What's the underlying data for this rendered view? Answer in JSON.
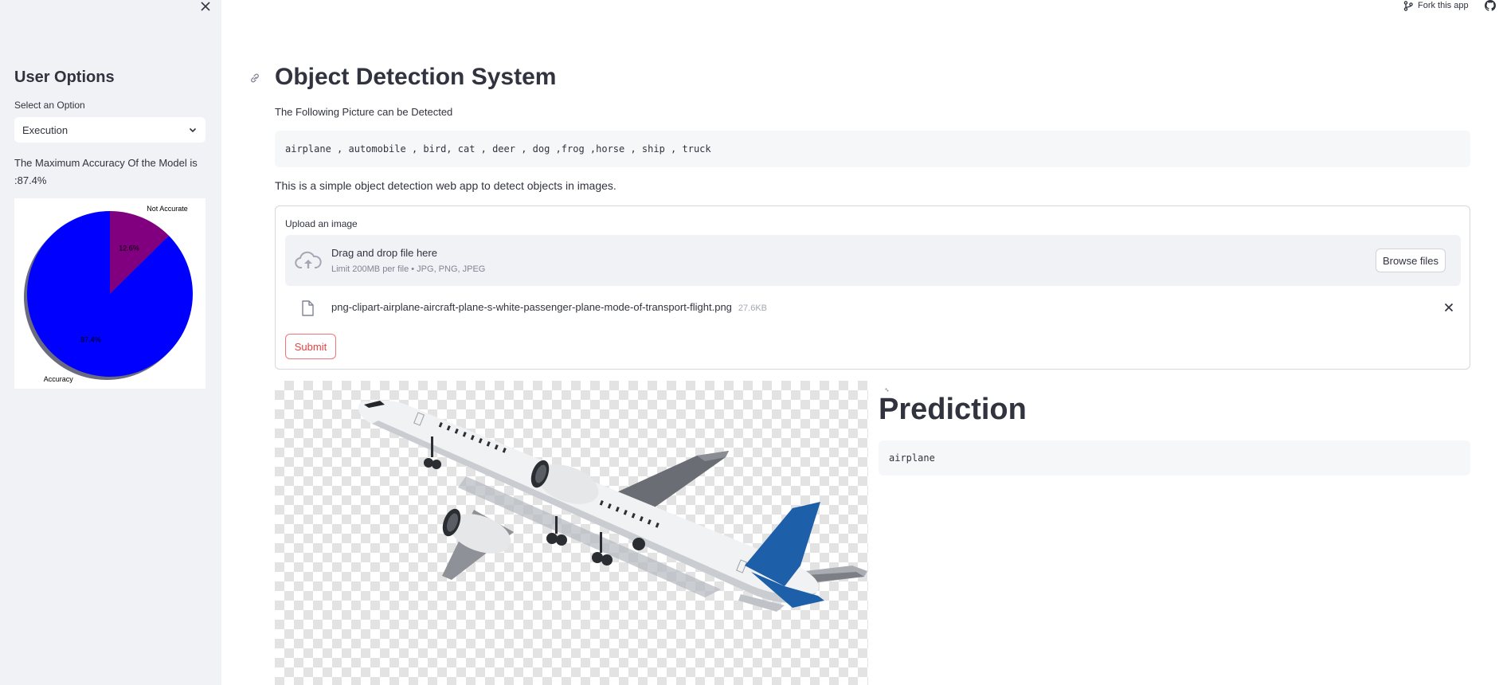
{
  "sidebar": {
    "title": "User Options",
    "select_label": "Select an Option",
    "select_value": "Execution",
    "accuracy_text": "The Maximum Accuracy Of the Model is :87.4%",
    "chart_data": {
      "type": "pie",
      "categories": [
        "Accuracy",
        "Not Accurate"
      ],
      "values": [
        87.4,
        12.6
      ],
      "value_labels": [
        "87.4%",
        "12.6%"
      ],
      "colors": [
        "#0000ff",
        "#800080"
      ],
      "shadow": true,
      "legend": "none"
    }
  },
  "header": {
    "fork_label": "Fork this app",
    "fork_icon": "fork-icon",
    "github_icon": "github-icon"
  },
  "main": {
    "title": "Object Detection System",
    "subtitle": "The Following Picture can be Detected",
    "classes_text": "airplane , automobile , bird, cat , deer , dog ,frog ,horse , ship , truck",
    "description": "This is a simple object detection web app to detect objects in images.",
    "upload": {
      "label": "Upload an image",
      "drag_text": "Drag and drop file here",
      "limit_text": "Limit 200MB per file • JPG, PNG, JPEG",
      "browse_label": "Browse files",
      "file_name": "png-clipart-airplane-aircraft-plane-s-white-passenger-plane-mode-of-transport-flight.png",
      "file_size": "27.6KB"
    },
    "submit_label": "Submit",
    "prediction": {
      "title": "Prediction",
      "result": "airplane"
    }
  },
  "colors": {
    "sidebar_bg": "#f0f2f6",
    "accent_red": "#ff4b4b",
    "plane_tail_blue": "#1d5fa8"
  }
}
